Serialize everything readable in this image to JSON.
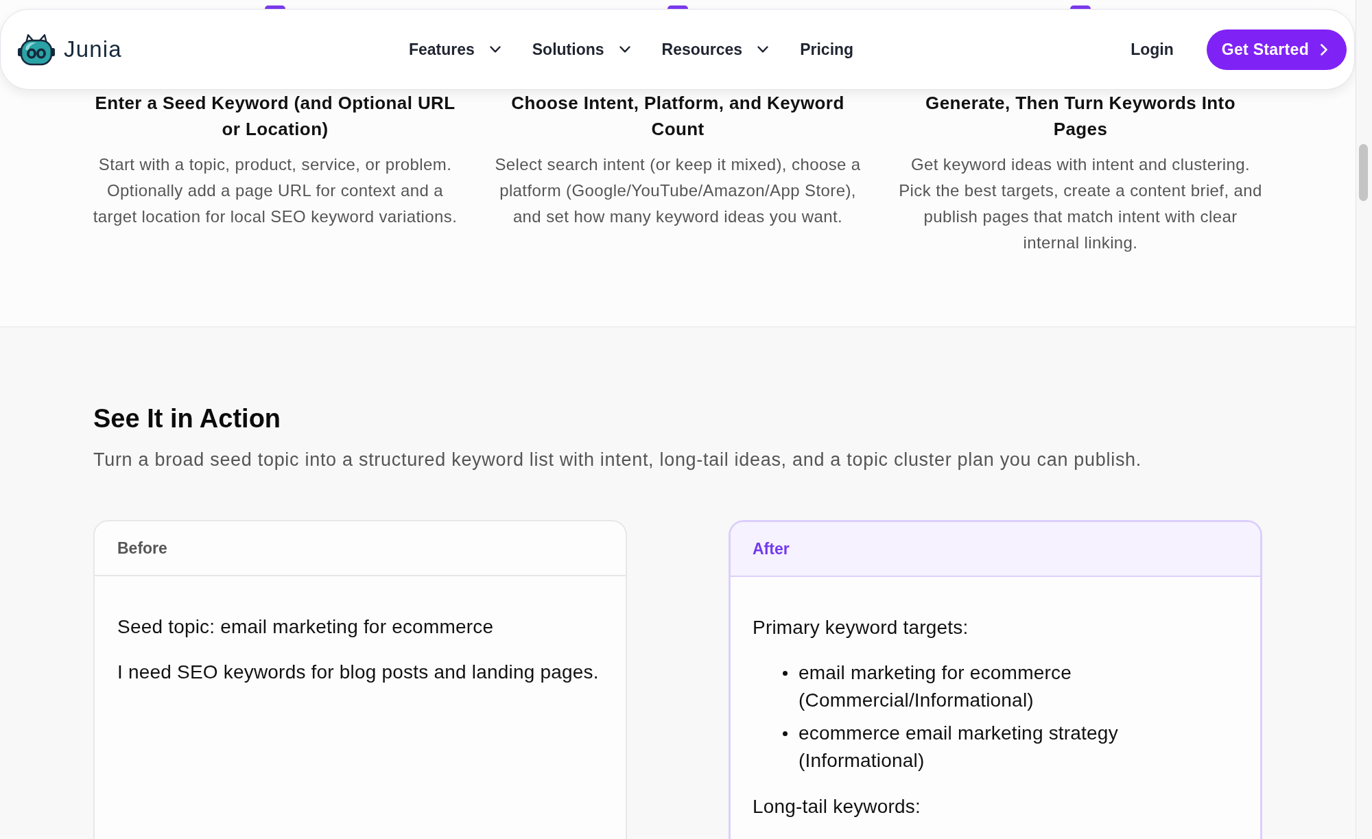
{
  "nav": {
    "logo_text": "Junia",
    "links": [
      {
        "label": "Features",
        "dropdown": true
      },
      {
        "label": "Solutions",
        "dropdown": true
      },
      {
        "label": "Resources",
        "dropdown": true
      },
      {
        "label": "Pricing",
        "dropdown": false
      }
    ],
    "login": "Login",
    "cta": "Get Started"
  },
  "steps": [
    {
      "title": "Enter a Seed Keyword (and Optional URL or Location)",
      "description": "Start with a topic, product, service, or problem. Optionally add a page URL for context and a target location for local SEO keyword variations."
    },
    {
      "title": "Choose Intent, Platform, and Keyword Count",
      "description": "Select search intent (or keep it mixed), choose a platform (Google/YouTube/Amazon/App Store), and set how many keyword ideas you want."
    },
    {
      "title": "Generate, Then Turn Keywords Into Pages",
      "description": "Get keyword ideas with intent and clustering. Pick the best targets, create a content brief, and publish pages that match intent with clear internal linking."
    }
  ],
  "action": {
    "title": "See It in Action",
    "subtitle": "Turn a broad seed topic into a structured keyword list with intent, long-tail ideas, and a topic cluster plan you can publish.",
    "panels": [
      {
        "label": "Before",
        "highlighted": false,
        "content": [
          {
            "kind": "paragraph",
            "text": "Seed topic: email marketing for ecommerce"
          },
          {
            "kind": "paragraph",
            "text": "I need SEO keywords for blog posts and landing pages."
          }
        ]
      },
      {
        "label": "After",
        "highlighted": true,
        "content": [
          {
            "kind": "paragraph",
            "text": "Primary keyword targets:"
          },
          {
            "kind": "list",
            "items": [
              "email marketing for ecommerce (Commercial/Informational)",
              "ecommerce email marketing strategy (Informational)"
            ]
          },
          {
            "kind": "paragraph",
            "text": "Long-tail keywords:"
          }
        ]
      }
    ]
  }
}
